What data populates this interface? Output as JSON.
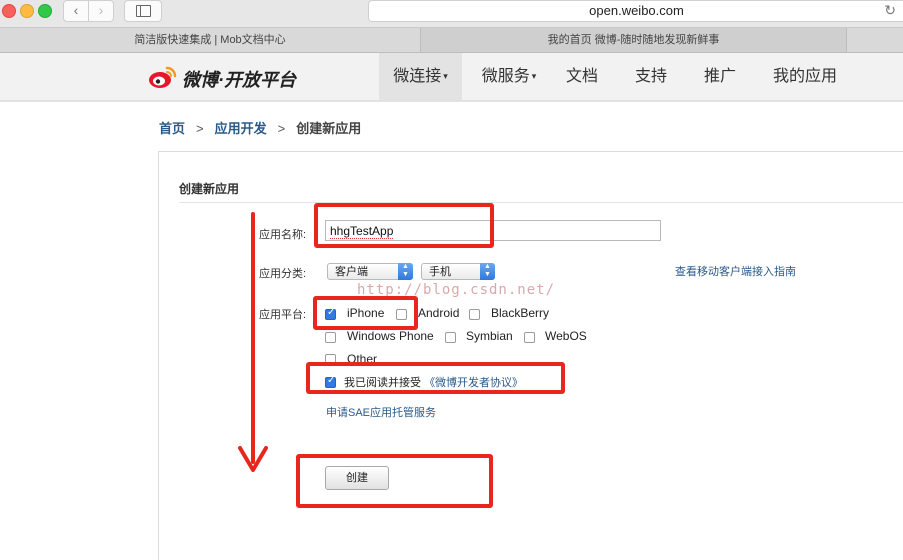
{
  "browser": {
    "url": "open.weibo.com",
    "nav_back": "‹",
    "nav_forward": "›",
    "reload_icon": "↻",
    "tabs": [
      {
        "label": "简洁版快速集成 | Mob文档中心"
      },
      {
        "label": "我的首页 微博-随时随地发现新鲜事"
      }
    ]
  },
  "header": {
    "logo_text": "微博·开放平台",
    "nav": [
      {
        "label": "微连接",
        "caret": "▾"
      },
      {
        "label": "微服务",
        "caret": "▾"
      },
      {
        "label": "文档"
      },
      {
        "label": "支持"
      },
      {
        "label": "推广"
      },
      {
        "label": "我的应用"
      }
    ]
  },
  "breadcrumb": {
    "items": [
      "首页",
      "应用开发",
      "创建新应用"
    ],
    "separator": ">"
  },
  "form": {
    "title": "创建新应用",
    "app_name_label": "应用名称:",
    "app_name_value": "hhgTestApp",
    "category_label": "应用分类:",
    "category_select": "客户端",
    "subcategory_select": "手机",
    "guide_link": "查看移动客户端接入指南",
    "platform_label": "应用平台:",
    "platforms": [
      {
        "label": "iPhone",
        "checked": true
      },
      {
        "label": "Android",
        "checked": false
      },
      {
        "label": "BlackBerry",
        "checked": false
      },
      {
        "label": "Windows Phone",
        "checked": false
      },
      {
        "label": "Symbian",
        "checked": false
      },
      {
        "label": "WebOS",
        "checked": false
      },
      {
        "label": "Other",
        "checked": false
      }
    ],
    "agree_text": "我已阅读并接受",
    "agree_link": "《微博开发者协议》",
    "agree_checked": true,
    "sae_link": "申请SAE应用托管服务",
    "submit_label": "创建"
  },
  "watermark": "http://blog.csdn.net/",
  "colors": {
    "annotation_red": "#e8261c",
    "link_blue": "#2a5a8a",
    "checkbox_blue": "#2f7be0"
  }
}
